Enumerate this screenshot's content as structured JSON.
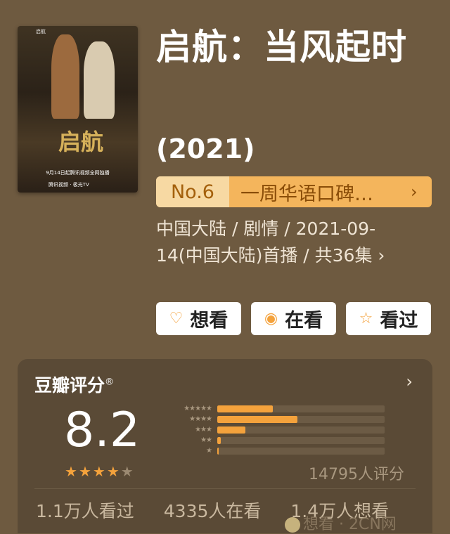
{
  "poster": {
    "brand": "启航",
    "calligraphy": "启航",
    "date_text": "9月14日起腾讯视频全网独播",
    "logos_text": "腾讯视频 · 极光TV"
  },
  "title": "启航：当风起时",
  "year": "(2021)",
  "rank": {
    "no": "No.6",
    "text": "一周华语口碑…"
  },
  "meta": {
    "line": "中国大陆 / 剧情 / 2021-09-14(中国大陆)首播 / 共36集 ›"
  },
  "actions": [
    {
      "label": "想看",
      "icon": "heart-plus-icon"
    },
    {
      "label": "在看",
      "icon": "target-icon"
    },
    {
      "label": "看过",
      "icon": "star-outline-icon"
    }
  ],
  "rating": {
    "header": "豆瓣评分",
    "reg_mark": "®",
    "score": "8.2",
    "stars": 4,
    "distribution": [
      0.33,
      0.48,
      0.17,
      0.02,
      0.01
    ],
    "star_labels": [
      "★★★★★",
      "★★★★",
      "★★★",
      "★★",
      "★"
    ],
    "count": "14795人评分",
    "stats": [
      "1.1万人看过",
      "4335人在看",
      "1.4万人想看"
    ]
  },
  "watermark": "想看 · 2CN网"
}
